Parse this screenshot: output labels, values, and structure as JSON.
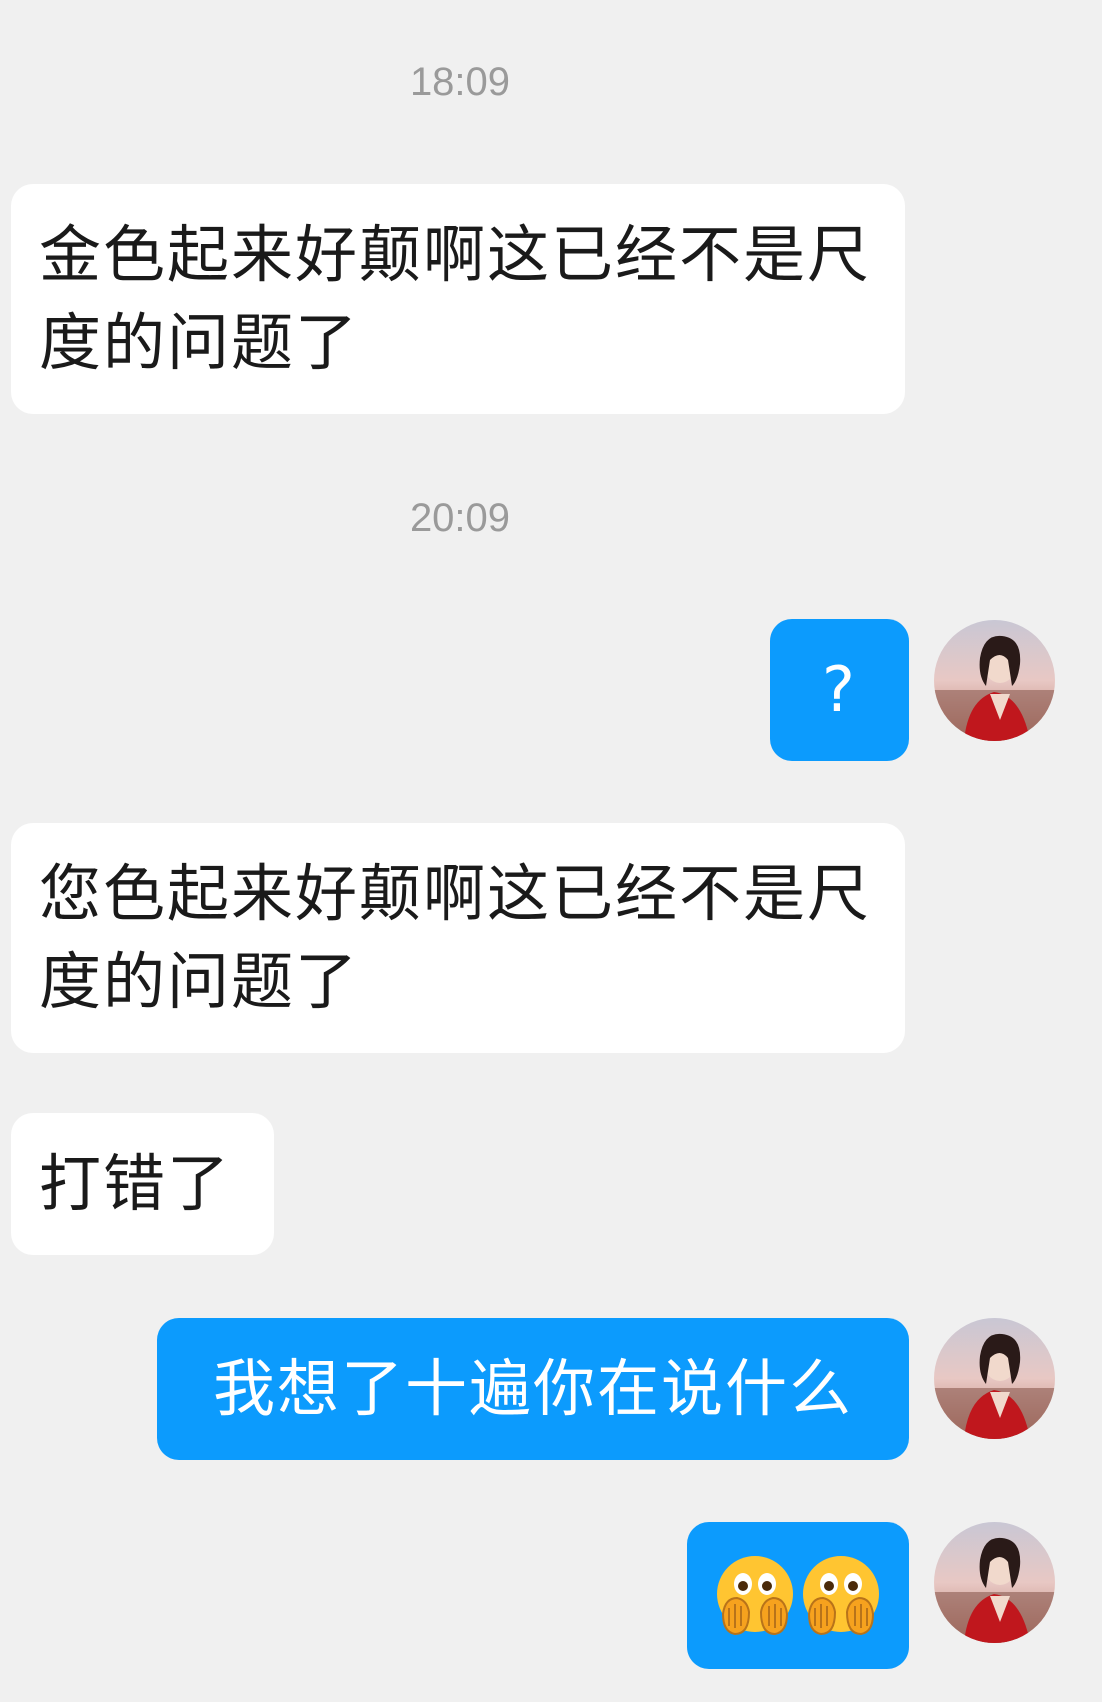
{
  "timestamps": [
    "18:09",
    "20:09"
  ],
  "messages": [
    {
      "side": "in",
      "text": "金色起来好颠啊这已经不是尺度的问题了"
    },
    {
      "side": "out",
      "text": "?"
    },
    {
      "side": "in",
      "text": "您色起来好颠啊这已经不是尺度的问题了"
    },
    {
      "side": "in",
      "text": "打错了"
    },
    {
      "side": "out",
      "text": "我想了十遍你在说什么"
    },
    {
      "side": "out",
      "emoji": [
        "hands-over-mouth-emoji",
        "hands-over-mouth-emoji"
      ]
    }
  ],
  "colors": {
    "background": "#f0f0f0",
    "incoming_bubble": "#ffffff",
    "outgoing_bubble": "#0c9bfd",
    "timestamp_text": "#9a9a9a"
  }
}
